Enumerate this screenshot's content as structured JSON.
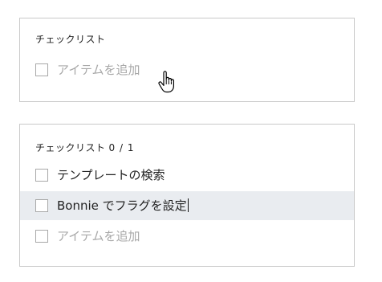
{
  "top_card": {
    "title": "チェックリスト",
    "add_item_placeholder": "アイテムを追加"
  },
  "bottom_card": {
    "title": "チェックリスト",
    "progress": "0 / 1",
    "items": [
      {
        "label": "テンプレートの検索",
        "checked": false
      },
      {
        "label": "Bonnie でフラグを設定",
        "checked": false,
        "editing": true
      }
    ],
    "add_item_placeholder": "アイテムを追加"
  },
  "icons": {
    "pointer": "hand-pointer-icon"
  },
  "colors": {
    "border": "#c9c9c9",
    "highlight_row": "#e9ecf0",
    "placeholder": "#a8a8a8"
  }
}
